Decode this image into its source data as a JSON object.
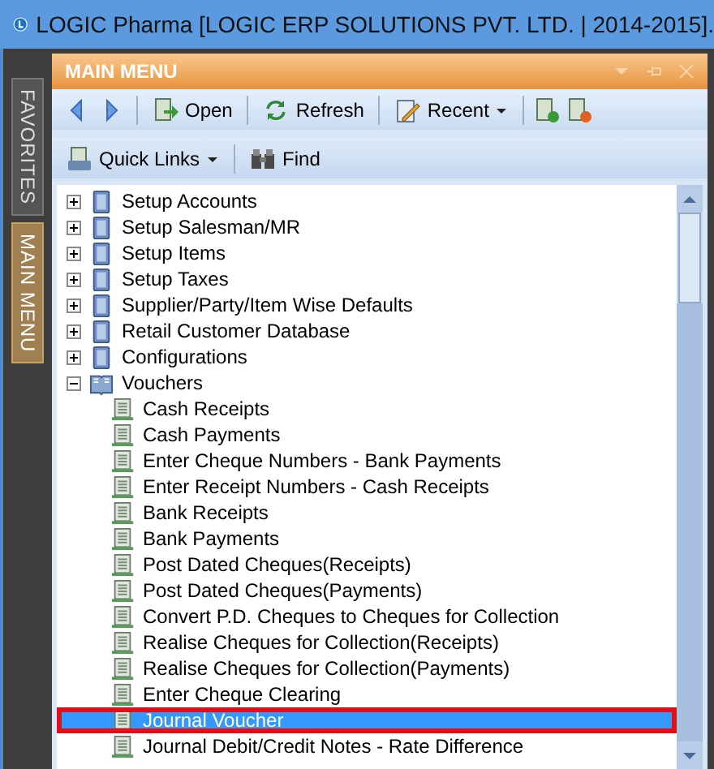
{
  "window": {
    "title": "LOGIC Pharma [LOGIC ERP SOLUTIONS PVT. LTD. | 2014-2015]."
  },
  "side_tabs": [
    {
      "label": "FAVORITES",
      "selected": false
    },
    {
      "label": "MAIN MENU",
      "selected": true
    }
  ],
  "panel": {
    "title": "MAIN MENU"
  },
  "toolbar": [
    {
      "kind": "back"
    },
    {
      "kind": "forward"
    },
    {
      "kind": "sep"
    },
    {
      "kind": "open",
      "label": "Open"
    },
    {
      "kind": "sep"
    },
    {
      "kind": "refresh",
      "label": "Refresh"
    },
    {
      "kind": "sep"
    },
    {
      "kind": "recent",
      "label": "Recent"
    },
    {
      "kind": "sep"
    },
    {
      "kind": "add"
    },
    {
      "kind": "remove"
    }
  ],
  "toolbar2": [
    {
      "kind": "links",
      "label": "Quick Links"
    },
    {
      "kind": "sep"
    },
    {
      "kind": "find",
      "label": "Find"
    }
  ],
  "tree": [
    {
      "label": "Setup Accounts",
      "expanded": false
    },
    {
      "label": "Setup Salesman/MR",
      "expanded": false
    },
    {
      "label": "Setup Items",
      "expanded": false
    },
    {
      "label": "Setup Taxes",
      "expanded": false
    },
    {
      "label": "Supplier/Party/Item Wise Defaults",
      "expanded": false
    },
    {
      "label": "Retail Customer Database",
      "expanded": false
    },
    {
      "label": "Configurations",
      "expanded": false
    },
    {
      "label": "Vouchers",
      "expanded": true,
      "children": [
        {
          "label": "Cash Receipts",
          "selected": false,
          "outlined": false
        },
        {
          "label": "Cash Payments",
          "selected": false,
          "outlined": false
        },
        {
          "label": "Enter Cheque Numbers - Bank Payments",
          "selected": false,
          "outlined": false
        },
        {
          "label": "Enter Receipt Numbers - Cash Receipts",
          "selected": false,
          "outlined": false
        },
        {
          "label": "Bank Receipts",
          "selected": false,
          "outlined": false
        },
        {
          "label": "Bank Payments",
          "selected": false,
          "outlined": false
        },
        {
          "label": "Post Dated Cheques(Receipts)",
          "selected": false,
          "outlined": false
        },
        {
          "label": "Post Dated Cheques(Payments)",
          "selected": false,
          "outlined": false
        },
        {
          "label": "Convert P.D. Cheques to Cheques for Collection",
          "selected": false,
          "outlined": false
        },
        {
          "label": "Realise Cheques for Collection(Receipts)",
          "selected": false,
          "outlined": false
        },
        {
          "label": "Realise Cheques for Collection(Payments)",
          "selected": false,
          "outlined": false
        },
        {
          "label": "Enter Cheque Clearing",
          "selected": false,
          "outlined": false
        },
        {
          "label": "Journal Voucher",
          "selected": true,
          "outlined": true
        },
        {
          "label": "Journal Debit/Credit Notes - Rate Difference",
          "selected": false,
          "outlined": false
        }
      ]
    }
  ]
}
